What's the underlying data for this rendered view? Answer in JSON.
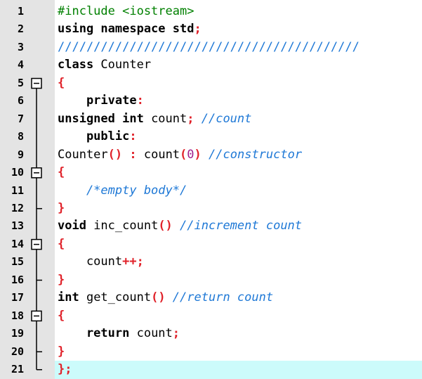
{
  "editor": {
    "lines": [
      {
        "num": "1",
        "tokens": [
          {
            "t": "#include <iostream>",
            "c": "pp"
          }
        ]
      },
      {
        "num": "2",
        "tokens": [
          {
            "t": "using namespace std",
            "c": "kw"
          },
          {
            "t": ";",
            "c": "op"
          }
        ]
      },
      {
        "num": "3",
        "tokens": [
          {
            "t": "//////////////////////////////////////////",
            "c": "cm-line"
          }
        ]
      },
      {
        "num": "4",
        "tokens": [
          {
            "t": "class ",
            "c": "kw"
          },
          {
            "t": "Counter",
            "c": "id"
          }
        ]
      },
      {
        "num": "5",
        "tokens": [
          {
            "t": "{",
            "c": "br"
          }
        ]
      },
      {
        "num": "6",
        "tokens": [
          {
            "t": "    private",
            "c": "kw"
          },
          {
            "t": ":",
            "c": "op"
          }
        ]
      },
      {
        "num": "7",
        "tokens": [
          {
            "t": "unsigned int ",
            "c": "kw"
          },
          {
            "t": "count",
            "c": "id"
          },
          {
            "t": ";",
            "c": "op"
          },
          {
            "t": " //count",
            "c": "cm"
          }
        ]
      },
      {
        "num": "8",
        "tokens": [
          {
            "t": "    public",
            "c": "kw"
          },
          {
            "t": ":",
            "c": "op"
          }
        ]
      },
      {
        "num": "9",
        "tokens": [
          {
            "t": "Counter",
            "c": "id"
          },
          {
            "t": "()",
            "c": "br"
          },
          {
            "t": " : ",
            "c": "op"
          },
          {
            "t": "count",
            "c": "id"
          },
          {
            "t": "(",
            "c": "br"
          },
          {
            "t": "0",
            "c": "num"
          },
          {
            "t": ")",
            "c": "br"
          },
          {
            "t": " //constructor",
            "c": "cm"
          }
        ]
      },
      {
        "num": "10",
        "tokens": [
          {
            "t": "{",
            "c": "br"
          }
        ]
      },
      {
        "num": "11",
        "tokens": [
          {
            "t": "    /*empty body*/",
            "c": "cm"
          }
        ]
      },
      {
        "num": "12",
        "tokens": [
          {
            "t": "}",
            "c": "br"
          }
        ]
      },
      {
        "num": "13",
        "tokens": [
          {
            "t": "void ",
            "c": "kw"
          },
          {
            "t": "inc_count",
            "c": "id"
          },
          {
            "t": "()",
            "c": "br"
          },
          {
            "t": " //increment count",
            "c": "cm"
          }
        ]
      },
      {
        "num": "14",
        "tokens": [
          {
            "t": "{",
            "c": "br"
          }
        ]
      },
      {
        "num": "15",
        "tokens": [
          {
            "t": "    count",
            "c": "id"
          },
          {
            "t": "++;",
            "c": "op"
          }
        ]
      },
      {
        "num": "16",
        "tokens": [
          {
            "t": "}",
            "c": "br"
          }
        ]
      },
      {
        "num": "17",
        "tokens": [
          {
            "t": "int ",
            "c": "kw"
          },
          {
            "t": "get_count",
            "c": "id"
          },
          {
            "t": "()",
            "c": "br"
          },
          {
            "t": " //return count",
            "c": "cm"
          }
        ]
      },
      {
        "num": "18",
        "tokens": [
          {
            "t": "{",
            "c": "br"
          }
        ]
      },
      {
        "num": "19",
        "tokens": [
          {
            "t": "    return ",
            "c": "kw"
          },
          {
            "t": "count",
            "c": "id"
          },
          {
            "t": ";",
            "c": "op"
          }
        ]
      },
      {
        "num": "20",
        "tokens": [
          {
            "t": "}",
            "c": "br"
          }
        ]
      },
      {
        "num": "21",
        "tokens": [
          {
            "t": "};",
            "c": "br"
          }
        ]
      }
    ],
    "fold_lines": [
      "5",
      "10",
      "14",
      "18"
    ],
    "current_line": "21",
    "colors": {
      "gutter": "#e4e4e4",
      "current_line_highlight": "#ccfbfb",
      "keyword": "#000000",
      "preprocessor": "#008000",
      "comment": "#1e78d6",
      "operator": "#e0222a",
      "number": "#a0208c"
    }
  }
}
